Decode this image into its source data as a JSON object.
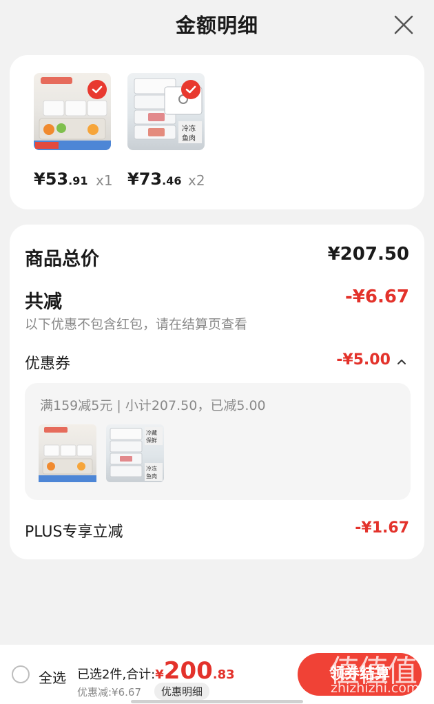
{
  "header": {
    "title": "金额明细"
  },
  "products": [
    {
      "price_int": "¥53",
      "price_dec": ".91",
      "qty": "x1"
    },
    {
      "price_int": "¥73",
      "price_dec": ".46",
      "qty": "x2"
    }
  ],
  "summary": {
    "total_label": "商品总价",
    "total_value": "¥207.50",
    "reduce_label": "共减",
    "reduce_value": "-¥6.67",
    "reduce_note": "以下优惠不包含红包，请在结算页查看",
    "coupon_label": "优惠券",
    "coupon_value": "-¥5.00",
    "coupon_detail": "满159减5元 | 小计207.50，已减5.00",
    "plus_label": "PLUS专享立减",
    "plus_value": "-¥1.67"
  },
  "bottom": {
    "select_all": "全选",
    "selected_text": "已选2件,合计:",
    "yen": "¥",
    "amount_int": "200",
    "amount_dec": ".83",
    "discount_text": "优惠减:¥6.67",
    "detail_label": "优惠明细",
    "checkout_label": "领券结算"
  },
  "watermark": {
    "title": "值值值",
    "url": "zhizhizhi.com"
  },
  "colors": {
    "accent": "#e3322b",
    "button": "#f04236",
    "background": "#f2f2f2"
  }
}
